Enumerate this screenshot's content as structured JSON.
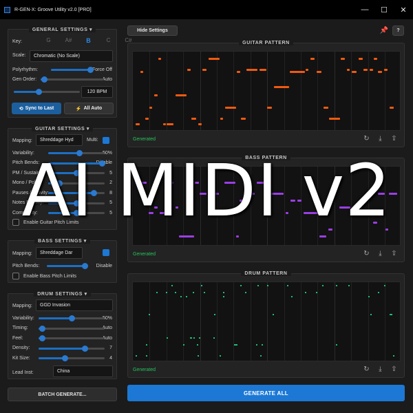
{
  "window": {
    "title": "R-GEN-X: Groove Utility v2.0 [PRO]",
    "minimize_glyph": "—",
    "maximize_glyph": "☐",
    "close_glyph": "✕"
  },
  "general": {
    "title": "GENERAL SETTINGS",
    "key_label": "Key:",
    "keys": [
      "G",
      "A#",
      "B",
      "C",
      "C#"
    ],
    "selected_key": "B",
    "scale_label": "Scale:",
    "scale_value": "Chromatic (No Scale)",
    "polyrhythm_label": "Polyrhythm:",
    "polyrhythm_value": "Force Off",
    "polyrhythm_level": 0.95,
    "gen_order_label": "Gen Order:",
    "gen_order_value": "Auto",
    "gen_order_level": 0.05,
    "tempo_level": 0.38,
    "bpm_value": "120 BPM",
    "sync_button": "Sync to Last",
    "auto_button": "All Auto"
  },
  "guitar": {
    "title": "GUITAR SETTINGS",
    "mapping_label": "Mapping:",
    "mapping_value": "Shreddage Hyd",
    "multi_label": "Multi:",
    "multi_checked": true,
    "sliders": [
      {
        "label": "Variability:",
        "value": "50%",
        "level": 0.55
      },
      {
        "label": "Pitch Bends:",
        "value": "Disable",
        "level": 0.95
      },
      {
        "label": "PM / Sustain:",
        "value": "5",
        "level": 0.5
      },
      {
        "label": "Mono / Poly:",
        "value": "2",
        "level": 0.2
      },
      {
        "label": "Pauses / Activity:",
        "value": "8",
        "level": 0.8
      },
      {
        "label": "Notes Density:",
        "value": "5",
        "level": 0.5
      },
      {
        "label": "Complexity:",
        "value": "5",
        "level": 0.5
      }
    ],
    "limits_label": "Enable Guitar Pitch Limits",
    "limits_checked": false
  },
  "bass": {
    "title": "BASS SETTINGS",
    "mapping_label": "Mapping:",
    "mapping_value": "Shreddage Dar",
    "multi_checked": true,
    "pitch_bends_label": "Pitch Bends:",
    "pitch_bends_value": "Disable",
    "pitch_bends_level": 0.95,
    "limits_label": "Enable Bass Pitch Limits",
    "limits_checked": false
  },
  "drum": {
    "title": "DRUM SETTINGS",
    "mapping_label": "Mapping:",
    "mapping_value": "GGD Invasion",
    "sliders": [
      {
        "label": "Variability:",
        "value": "50%",
        "level": 0.5
      },
      {
        "label": "Timing:",
        "value": "Auto",
        "level": 0.05
      },
      {
        "label": "Feel:",
        "value": "Auto",
        "level": 0.05
      },
      {
        "label": "Density:",
        "value": "7",
        "level": 0.7
      },
      {
        "label": "Kit Size:",
        "value": "4",
        "level": 0.4
      }
    ],
    "lead_label": "Lead Inst:",
    "lead_value": "China"
  },
  "toolbar": {
    "hide_settings": "Hide Settings",
    "pin_glyph": "📌",
    "help": "?"
  },
  "patterns": [
    {
      "title": "GUITAR PATTERN",
      "status": "Generated",
      "color": "#f05a10",
      "kind": "notes"
    },
    {
      "title": "BASS PATTERN",
      "status": "Generated",
      "color": "#9b3ee6",
      "kind": "notes"
    },
    {
      "title": "DRUM PATTERN",
      "status": "Generated",
      "color": "#1fbf72",
      "kind": "dots"
    }
  ],
  "pattern_icons": {
    "regen": "↻",
    "download": "⤓",
    "export": "⇪"
  },
  "batch_button": "BATCH GENERATE...",
  "generate_all": "GENERATE ALL",
  "overlay_text": "AI MIDI v2",
  "colors": {
    "accent": "#1c78d4",
    "status_green": "#25c25c"
  }
}
